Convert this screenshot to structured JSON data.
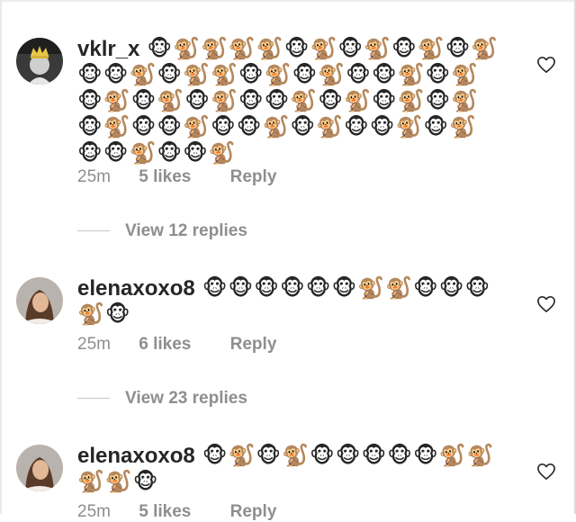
{
  "comments": [
    {
      "username": "vklr_x",
      "text": "🐵🐒🐒🐒🐒🐵🐒🐵🐒🐵🐒🐵🐒🐵🐵🐒🐵🐒🐒🐵🐒🐵🐒🐵🐵🐒🐵🐒🐵🐒🐵🐒🐵🐒🐵🐵🐒🐵🐒🐵🐒🐵🐒🐵🐒🐵🐵🐒🐵🐵🐒🐵🐒🐵🐵🐒🐵🐒🐵🐵🐒🐵🐵🐒",
      "time": "25m",
      "likes": "5 likes",
      "reply_label": "Reply",
      "view_replies": "View 12 replies",
      "avatar_icon": "avatar-crown-icon"
    },
    {
      "username": "elenaxoxo8",
      "text": "🐵🐵🐵🐵🐵🐵🐒🐒🐵🐵🐵🐒🐵",
      "time": "25m",
      "likes": "6 likes",
      "reply_label": "Reply",
      "view_replies": "View 23 replies",
      "avatar_icon": "avatar-photo-icon"
    },
    {
      "username": "elenaxoxo8",
      "text": "🐵🐒🐵🐒🐵🐵🐵🐵🐵🐒🐒🐒🐒🐵",
      "time": "25m",
      "likes": "5 likes",
      "reply_label": "Reply",
      "avatar_icon": "avatar-photo-icon"
    }
  ],
  "icons": {
    "like": "heart-outline-icon"
  },
  "colors": {
    "text": "#262626",
    "secondary": "#8e8e8e"
  }
}
